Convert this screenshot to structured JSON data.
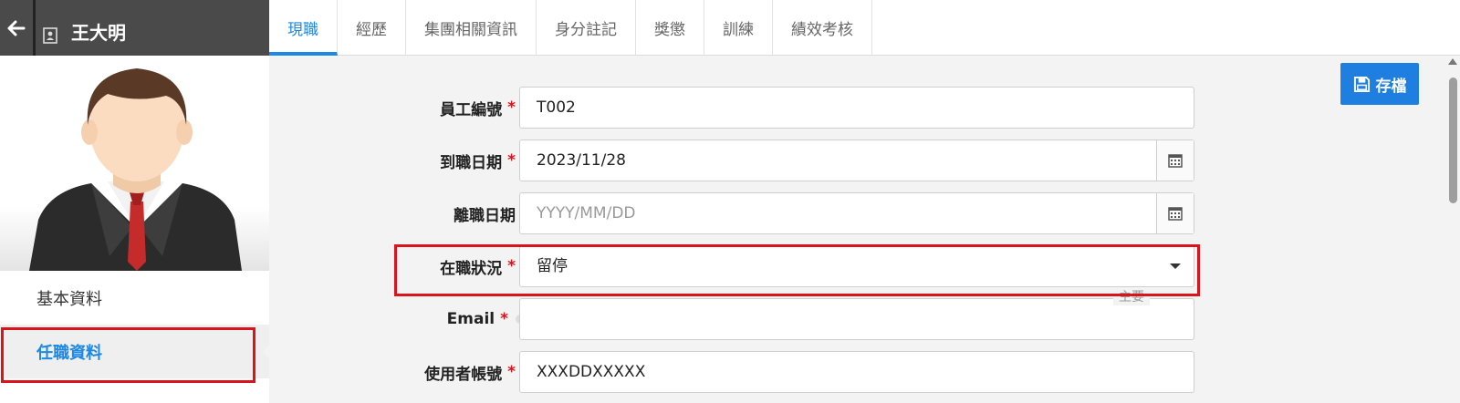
{
  "header": {
    "user_name": "王大明"
  },
  "left_nav": {
    "items": [
      {
        "label": "基本資料"
      },
      {
        "label": "任職資料"
      }
    ]
  },
  "tabs": [
    {
      "label": "現職"
    },
    {
      "label": "經歷"
    },
    {
      "label": "集團相關資訊"
    },
    {
      "label": "身分註記"
    },
    {
      "label": "獎懲"
    },
    {
      "label": "訓練"
    },
    {
      "label": "績效考核"
    }
  ],
  "toolbar": {
    "save_label": "存檔"
  },
  "form": {
    "employee_id": {
      "label": "員工編號",
      "value": "T002",
      "required": "*"
    },
    "hire_date": {
      "label": "到職日期",
      "value": "2023/11/28",
      "required": "*"
    },
    "leave_date": {
      "label": "離職日期",
      "placeholder": "YYYY/MM/DD"
    },
    "employment_status": {
      "label": "在職狀況",
      "value": "留停",
      "required": "*"
    },
    "email": {
      "label": "Email",
      "value": "",
      "required": "*",
      "legend": "主要"
    },
    "username": {
      "label": "使用者帳號",
      "value": "XXXDDXXXXX",
      "required": "*"
    }
  },
  "colors": {
    "accent": "#1e88e5",
    "highlight": "#d9141b",
    "header_bg": "#4a4a4a"
  }
}
